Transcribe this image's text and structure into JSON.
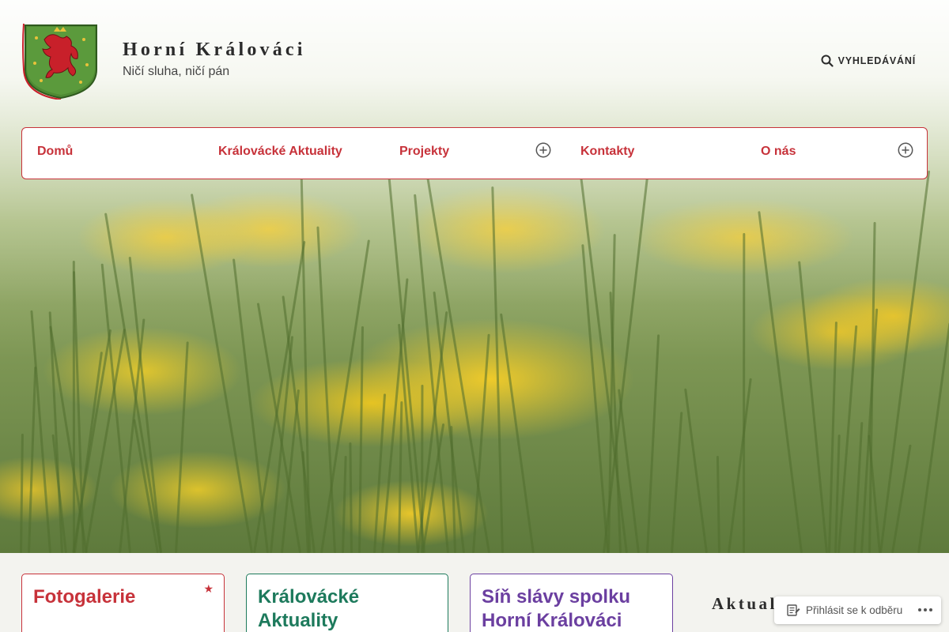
{
  "site": {
    "title": "Horní Králováci",
    "tagline": "Ničí sluha, ničí pán",
    "logo_icon": "coat-of-arms-red-lion"
  },
  "search": {
    "label": "VYHLEDÁVÁNÍ",
    "icon": "search-icon"
  },
  "nav": {
    "items": [
      {
        "label": "Domů",
        "has_submenu": false
      },
      {
        "label": "Královácké Aktuality",
        "has_submenu": false
      },
      {
        "label": "Projekty",
        "has_submenu": true
      },
      {
        "label": "Kontakty",
        "has_submenu": false
      },
      {
        "label": "O nás",
        "has_submenu": true
      }
    ],
    "expand_icon": "plus-circle-icon"
  },
  "cards": [
    {
      "title": "Fotogalerie",
      "color": "#c7323a",
      "sticky": true,
      "sticky_icon": "star-icon"
    },
    {
      "title": "Královácké Aktuality",
      "color": "#1d7a5c"
    },
    {
      "title": "Síň slávy spolku Horní Králováci",
      "color": "#6b3fa0"
    }
  ],
  "sidebar": {
    "widget_title": "Aktuality"
  },
  "follow_bar": {
    "label": "Přihlásit se k odběru",
    "icon": "reader-icon",
    "more_icon": "more-dots-icon"
  },
  "colors": {
    "accent": "#c7323a",
    "text": "#2b2b2b"
  }
}
